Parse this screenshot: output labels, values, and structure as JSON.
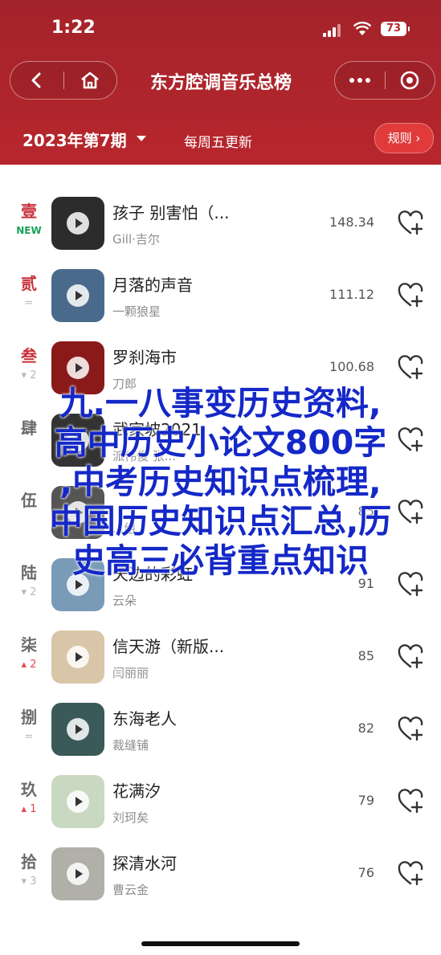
{
  "status": {
    "time": "1:22",
    "battery": "73"
  },
  "nav": {
    "title": "东方腔调音乐总榜"
  },
  "subheader": {
    "week": "2023年第7期",
    "update": "每周五更新",
    "rules": "规则 ›"
  },
  "songs": [
    {
      "rank": "壹",
      "trend": "NEW",
      "trend_type": "new",
      "title": "孩子 别害怕（...",
      "artist": "Gill·吉尔",
      "score": "148.34",
      "cover": "#2c2c2c"
    },
    {
      "rank": "贰",
      "trend": "=",
      "trend_type": "same",
      "title": "月落的声音",
      "artist": "一颗狼星",
      "score": "111.12",
      "cover": "#4a6a8c"
    },
    {
      "rank": "叁",
      "trend": "▾ 2",
      "trend_type": "down",
      "title": "罗刹海市",
      "artist": "刀郎",
      "score": "100.68",
      "cover": "#8a1a1a"
    },
    {
      "rank": "肆",
      "trend": "",
      "trend_type": "down",
      "title": "武家坡2021",
      "artist": "派伟俊 张...",
      "score": "",
      "cover": "#333"
    },
    {
      "rank": "伍",
      "trend": "",
      "trend_type": "down",
      "title": "",
      "artist": "...组",
      "score": "85",
      "cover": "#555"
    },
    {
      "rank": "陆",
      "trend": "▾ 2",
      "trend_type": "down",
      "title": "天边的彩虹",
      "artist": "云朵",
      "score": "91",
      "cover": "#7a9bb8"
    },
    {
      "rank": "柒",
      "trend": "▴ 2",
      "trend_type": "up",
      "title": "信天游（新版...",
      "artist": "闫丽丽",
      "score": "85",
      "cover": "#d9c6a8"
    },
    {
      "rank": "捌",
      "trend": "=",
      "trend_type": "same",
      "title": "东海老人",
      "artist": "裁缝铺",
      "score": "82",
      "cover": "#3a5a5a"
    },
    {
      "rank": "玖",
      "trend": "▴ 1",
      "trend_type": "up",
      "title": "花满汐",
      "artist": "刘珂矣",
      "score": "79",
      "cover": "#c9d8c0"
    },
    {
      "rank": "拾",
      "trend": "▾ 3",
      "trend_type": "down",
      "title": "探清水河",
      "artist": "曹云金",
      "score": "76",
      "cover": "#b0b0a8"
    }
  ],
  "overlay": {
    "lines": [
      "九.一八事变历史资料,",
      "高中历史小论文800字",
      ",中考历史知识点梳理,",
      "中国历史知识点汇总,历",
      "史高三必背重点知识"
    ]
  }
}
